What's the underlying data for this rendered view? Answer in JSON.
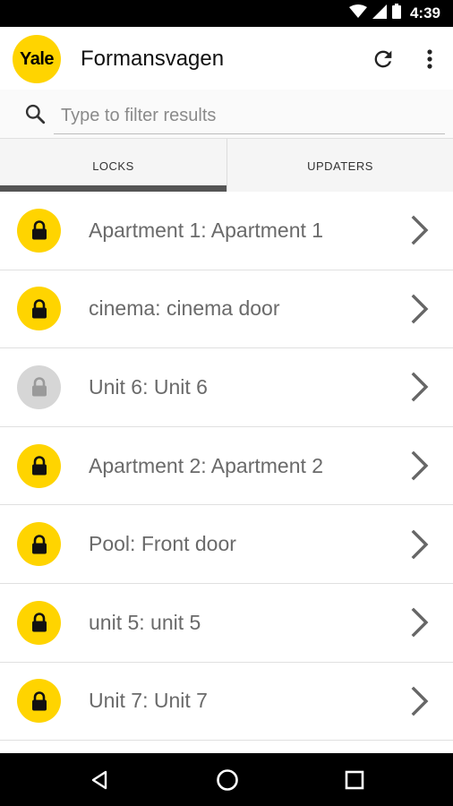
{
  "status_bar": {
    "time": "4:39",
    "icons": [
      "wifi-icon",
      "signal-icon",
      "battery-icon"
    ]
  },
  "app_bar": {
    "logo_text": "Yale",
    "title": "Formansvagen",
    "actions": [
      "refresh-icon",
      "more-vert-icon"
    ]
  },
  "search": {
    "placeholder": "Type to filter results",
    "value": ""
  },
  "tabs": [
    {
      "label": "LOCKS",
      "selected": true
    },
    {
      "label": "UPDATERS",
      "selected": false
    }
  ],
  "locks": [
    {
      "name": "Apartment 1: Apartment 1",
      "status": "active"
    },
    {
      "name": "cinema: cinema door",
      "status": "active"
    },
    {
      "name": "Unit 6: Unit 6",
      "status": "inactive"
    },
    {
      "name": "Apartment 2: Apartment 2",
      "status": "active"
    },
    {
      "name": "Pool: Front door",
      "status": "active"
    },
    {
      "name": "unit 5: unit 5",
      "status": "active"
    },
    {
      "name": "Unit 7: Unit 7",
      "status": "active"
    }
  ],
  "nav_bar": {
    "buttons": [
      "back-icon",
      "home-icon",
      "recents-icon"
    ]
  },
  "colors": {
    "brand_yellow": "#ffd400",
    "inactive_gray": "#d6d6d6",
    "tab_indicator": "#555555"
  }
}
